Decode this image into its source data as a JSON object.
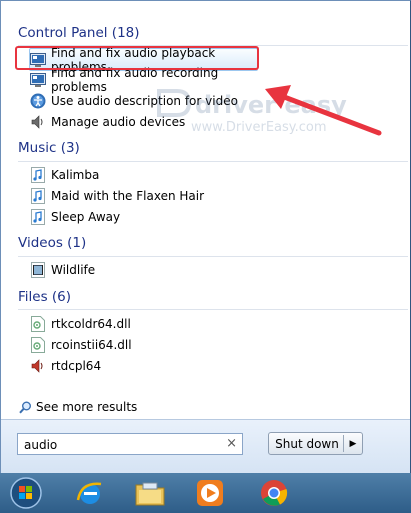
{
  "categories": {
    "control_panel": "Control Panel (18)",
    "music": "Music (3)",
    "videos": "Videos (1)",
    "files": "Files (6)"
  },
  "control_panel_items": [
    {
      "label": "Find and fix audio playback problems",
      "icon": "troubleshoot-icon"
    },
    {
      "label": "Find and fix audio recording problems",
      "icon": "troubleshoot-icon"
    },
    {
      "label": "Use audio description for video",
      "icon": "ease-of-access-icon"
    },
    {
      "label": "Manage audio devices",
      "icon": "speaker-icon"
    }
  ],
  "music_items": [
    {
      "label": "Kalimba",
      "icon": "music-note-icon"
    },
    {
      "label": "Maid with the Flaxen Hair",
      "icon": "music-note-icon"
    },
    {
      "label": "Sleep Away",
      "icon": "music-note-icon"
    }
  ],
  "video_items": [
    {
      "label": "Wildlife",
      "icon": "video-file-icon"
    }
  ],
  "file_items": [
    {
      "label": "rtkcoldr64.dll",
      "icon": "dll-file-icon"
    },
    {
      "label": "rcoinstii64.dll",
      "icon": "dll-file-icon"
    },
    {
      "label": "rtdcpl64",
      "icon": "speaker-icon"
    }
  ],
  "see_more": "See more results",
  "search": {
    "value": "audio",
    "clear": "×"
  },
  "shutdown": {
    "label": "Shut down",
    "arrow": "▶"
  },
  "watermark": {
    "brand": "driver easy",
    "url": "www.DriverEasy.com"
  },
  "colors": {
    "category": "#1e3287",
    "highlight_border": "#9cc7ef",
    "annotation_red": "#e8343f",
    "taskbar": "#2e5d88"
  },
  "taskbar": [
    "start-orb-icon",
    "internet-explorer-icon",
    "file-explorer-icon",
    "media-player-icon",
    "chrome-icon"
  ]
}
